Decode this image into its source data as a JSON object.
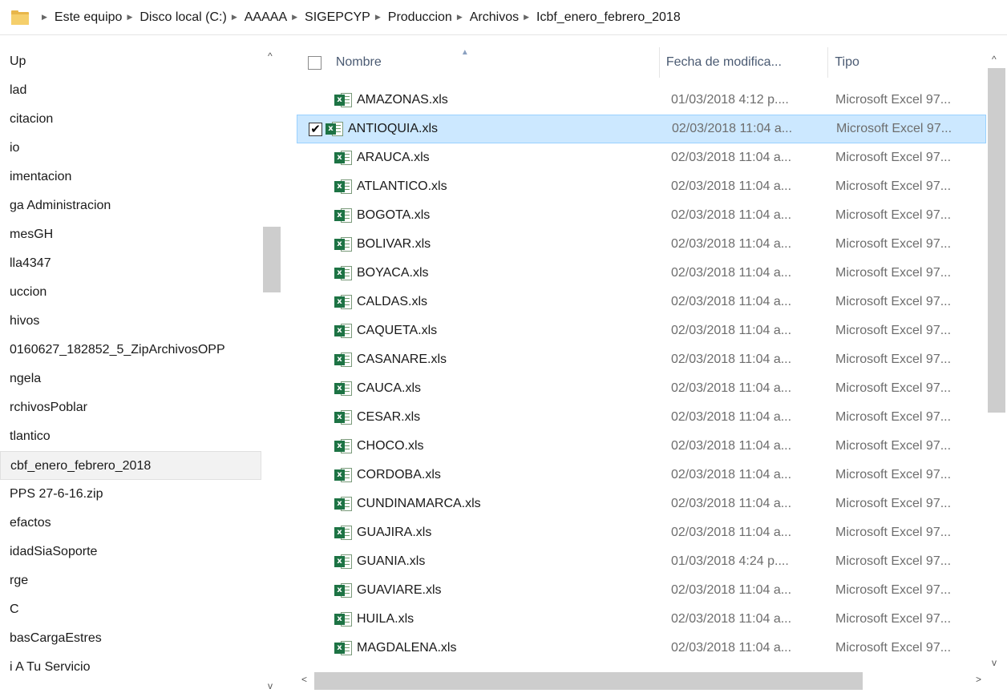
{
  "breadcrumb": [
    "Este equipo",
    "Disco local (C:)",
    "AAAAA",
    "SIGEPCYP",
    "Produccion",
    "Archivos",
    "Icbf_enero_febrero_2018"
  ],
  "nav_items": [
    "Up",
    "lad",
    "citacion",
    "io",
    "imentacion",
    "ga Administracion",
    "mesGH",
    "lla4347",
    "uccion",
    "hivos",
    "0160627_182852_5_ZipArchivosOPP",
    "ngela",
    "rchivosPoblar",
    "tlantico",
    "cbf_enero_febrero_2018",
    "PPS 27-6-16.zip",
    "efactos",
    "idadSiaSoporte",
    "rge",
    "C",
    "basCargaEstres",
    "i A Tu Servicio"
  ],
  "nav_selected_index": 14,
  "columns": {
    "name": "Nombre",
    "date": "Fecha de modifica...",
    "type": "Tipo"
  },
  "icons": {
    "folder": "folder-icon",
    "file": "excel-file-icon",
    "checkmark": "✔"
  },
  "files": [
    {
      "name": "AMAZONAS.xls",
      "date": "01/03/2018 4:12 p....",
      "type": "Microsoft Excel 97..."
    },
    {
      "name": "ANTIOQUIA.xls",
      "date": "02/03/2018 11:04 a...",
      "type": "Microsoft Excel 97...",
      "selected": true
    },
    {
      "name": "ARAUCA.xls",
      "date": "02/03/2018 11:04 a...",
      "type": "Microsoft Excel 97..."
    },
    {
      "name": "ATLANTICO.xls",
      "date": "02/03/2018 11:04 a...",
      "type": "Microsoft Excel 97..."
    },
    {
      "name": "BOGOTA.xls",
      "date": "02/03/2018 11:04 a...",
      "type": "Microsoft Excel 97..."
    },
    {
      "name": "BOLIVAR.xls",
      "date": "02/03/2018 11:04 a...",
      "type": "Microsoft Excel 97..."
    },
    {
      "name": "BOYACA.xls",
      "date": "02/03/2018 11:04 a...",
      "type": "Microsoft Excel 97..."
    },
    {
      "name": "CALDAS.xls",
      "date": "02/03/2018 11:04 a...",
      "type": "Microsoft Excel 97..."
    },
    {
      "name": "CAQUETA.xls",
      "date": "02/03/2018 11:04 a...",
      "type": "Microsoft Excel 97..."
    },
    {
      "name": "CASANARE.xls",
      "date": "02/03/2018 11:04 a...",
      "type": "Microsoft Excel 97..."
    },
    {
      "name": "CAUCA.xls",
      "date": "02/03/2018 11:04 a...",
      "type": "Microsoft Excel 97..."
    },
    {
      "name": "CESAR.xls",
      "date": "02/03/2018 11:04 a...",
      "type": "Microsoft Excel 97..."
    },
    {
      "name": "CHOCO.xls",
      "date": "02/03/2018 11:04 a...",
      "type": "Microsoft Excel 97..."
    },
    {
      "name": "CORDOBA.xls",
      "date": "02/03/2018 11:04 a...",
      "type": "Microsoft Excel 97..."
    },
    {
      "name": "CUNDINAMARCA.xls",
      "date": "02/03/2018 11:04 a...",
      "type": "Microsoft Excel 97..."
    },
    {
      "name": "GUAJIRA.xls",
      "date": "02/03/2018 11:04 a...",
      "type": "Microsoft Excel 97..."
    },
    {
      "name": "GUANIA.xls",
      "date": "01/03/2018 4:24 p....",
      "type": "Microsoft Excel 97..."
    },
    {
      "name": "GUAVIARE.xls",
      "date": "02/03/2018 11:04 a...",
      "type": "Microsoft Excel 97..."
    },
    {
      "name": "HUILA.xls",
      "date": "02/03/2018 11:04 a...",
      "type": "Microsoft Excel 97..."
    },
    {
      "name": "MAGDALENA.xls",
      "date": "02/03/2018 11:04 a...",
      "type": "Microsoft Excel 97..."
    }
  ],
  "colors": {
    "selection_bg": "#cce8ff",
    "selection_border": "#99d1ff",
    "header_text": "#4a5a72",
    "excel_green": "#1d7344"
  }
}
